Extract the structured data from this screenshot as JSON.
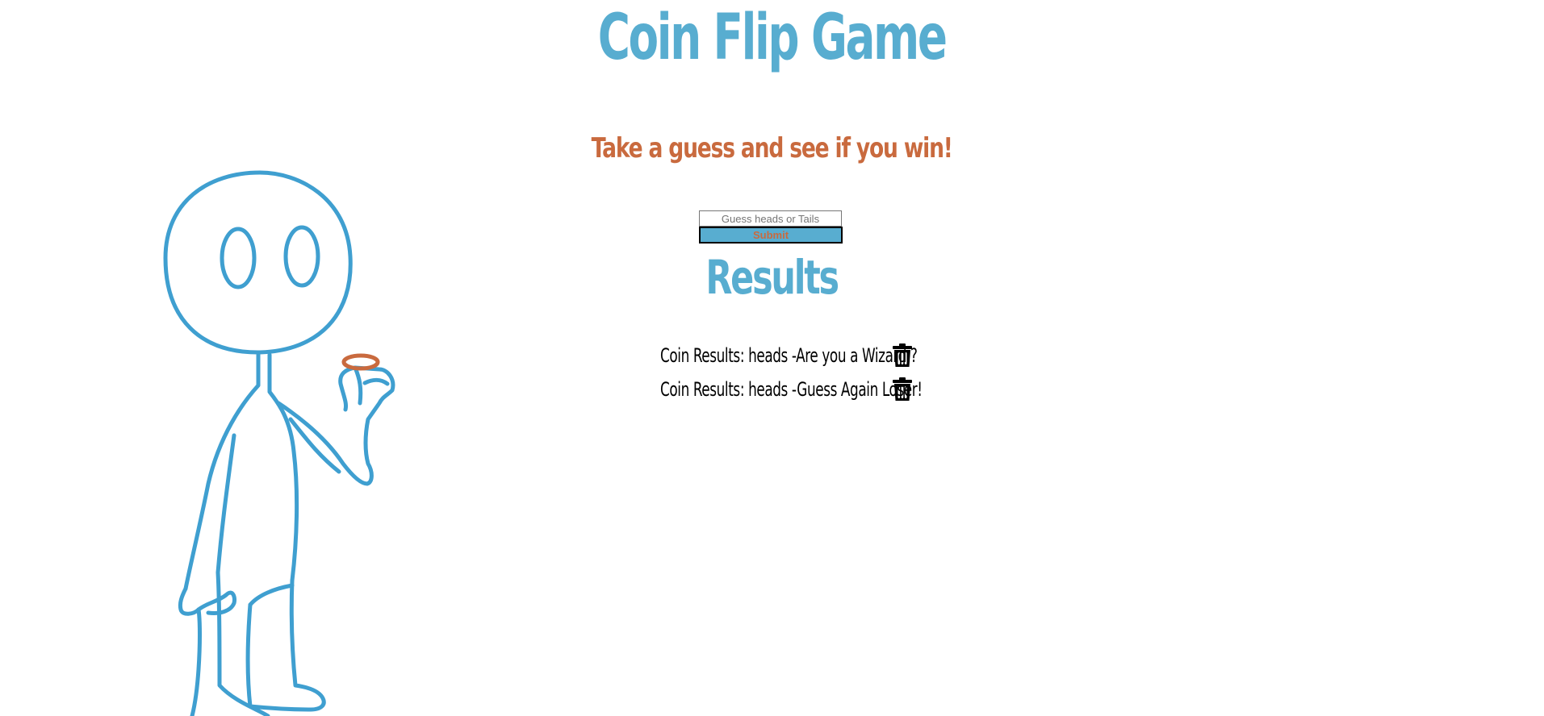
{
  "header": {
    "title": "Coin Flip Game",
    "subtitle": "Take a guess and see if you win!"
  },
  "form": {
    "input_placeholder": "Guess heads or Tails",
    "input_value": "",
    "submit_label": "Submit"
  },
  "results": {
    "heading": "Results",
    "items": [
      {
        "text": "Coin Results: heads -Are you a Wizard ?"
      },
      {
        "text": "Coin Results: heads -Guess Again Loser!"
      }
    ]
  },
  "colors": {
    "title": "#58add0",
    "subtitle": "#c96a3e",
    "button_bg": "#58add0",
    "figure_stroke": "#3f9fd0",
    "coin": "#c96a3e"
  },
  "icons": {
    "delete": "trash-icon",
    "illustration": "stick-figure-holding-coin"
  }
}
